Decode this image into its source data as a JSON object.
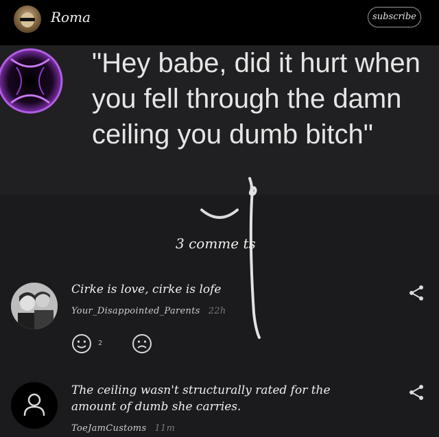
{
  "header": {
    "username": "Roma",
    "subscribe_label": "subscribe"
  },
  "post": {
    "text": "\"Hey babe, did it hurt when you fell through the damn ceiling you dumb bitch\""
  },
  "comments_section": {
    "count_label": "3 comme  ts"
  },
  "comments": [
    {
      "text": "Cirke is love, cirke is lofe",
      "author": "Your_Disappointed_Parents",
      "time": "22h",
      "likes": "2"
    },
    {
      "text": "The ceiling wasn't structurally rated for the amount of dumb she carries.",
      "author": "ToeJamCustoms",
      "time": "11m"
    }
  ],
  "colors": {
    "background": "#1b1b1d",
    "header": "#000000",
    "accent_purple": "#a64bd6"
  },
  "icons": [
    "avatar",
    "purple-portal-icon",
    "chevron-down-icon",
    "share-icon",
    "smile-icon",
    "frown-icon",
    "user-placeholder-icon"
  ]
}
